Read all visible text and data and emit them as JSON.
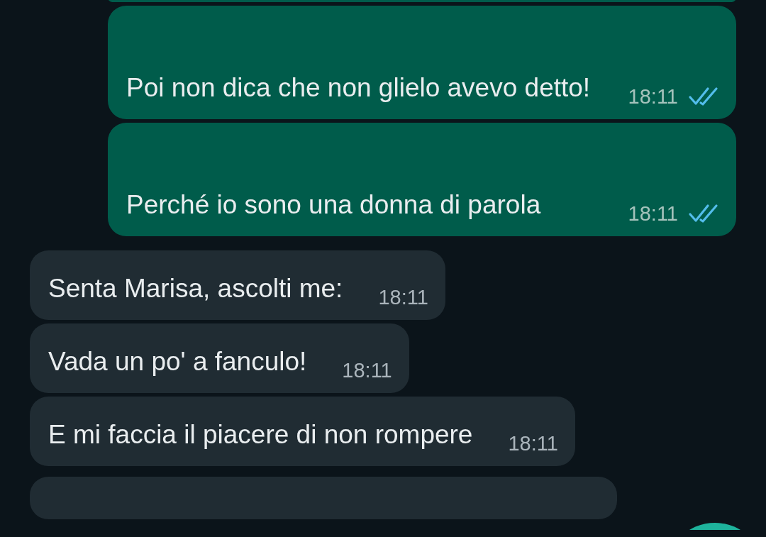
{
  "messages": [
    {
      "kind": "outgoing",
      "text": "Poi non dica che non glielo avevo detto!",
      "time": "18:11",
      "read": true
    },
    {
      "kind": "outgoing",
      "text": "Perché io sono una donna di parola",
      "time": "18:11",
      "read": true
    },
    {
      "kind": "incoming",
      "text": "Senta Marisa, ascolti me:",
      "time": "18:11"
    },
    {
      "kind": "incoming",
      "text": "Vada un po' a fanculo!",
      "time": "18:11"
    },
    {
      "kind": "incoming",
      "text": "E mi faccia il piacere di non rompere",
      "time": "18:11"
    }
  ]
}
